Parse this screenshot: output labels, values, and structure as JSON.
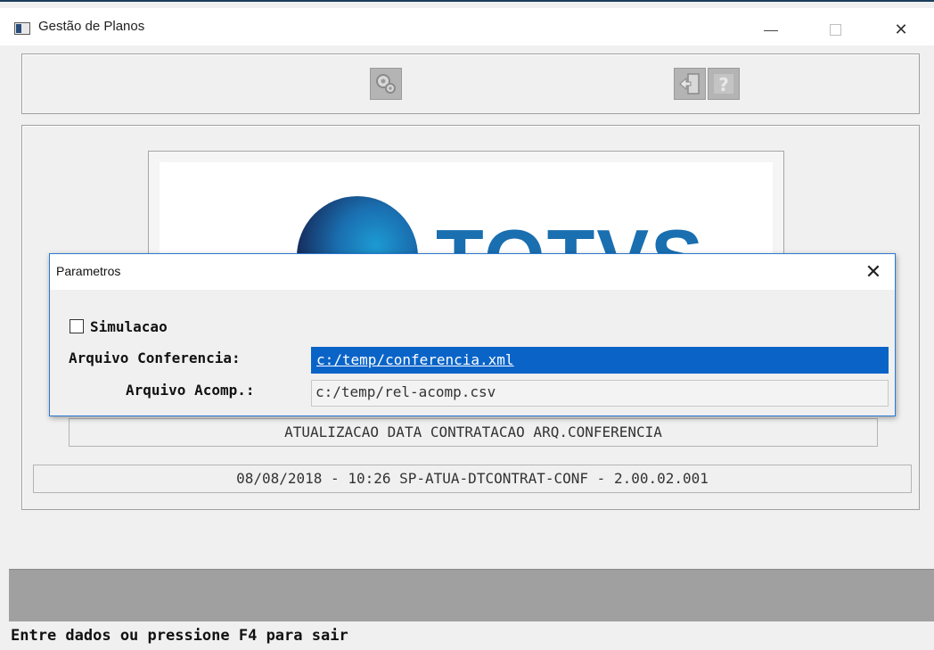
{
  "window": {
    "title": "Gestão de Planos",
    "controls": {
      "minimize": "—",
      "maximize": "☐",
      "close": "✕"
    }
  },
  "toolbar": {
    "icons": [
      "execute-gears-icon",
      "exit-door-icon",
      "help-question-icon"
    ]
  },
  "logo": {
    "text": "TOTVS"
  },
  "dialog": {
    "title": "Parametros",
    "close": "✕",
    "simulacao_label": "Simulacao",
    "simulacao_checked": false,
    "arquivo_conferencia_label": "Arquivo Conferencia:",
    "arquivo_conferencia_value": "c:/temp/conferencia.xml",
    "arquivo_acomp_label": "Arquivo Acomp.:",
    "arquivo_acomp_value": "c:/temp/rel-acomp.csv"
  },
  "program": {
    "description": "ATUALIZACAO DATA CONTRATACAO ARQ.CONFERENCIA",
    "version_line": "08/08/2018 - 10:26  SP-ATUA-DTCONTRAT-CONF - 2.00.02.001"
  },
  "status": {
    "message": "Entre dados ou pressione F4 para sair"
  }
}
